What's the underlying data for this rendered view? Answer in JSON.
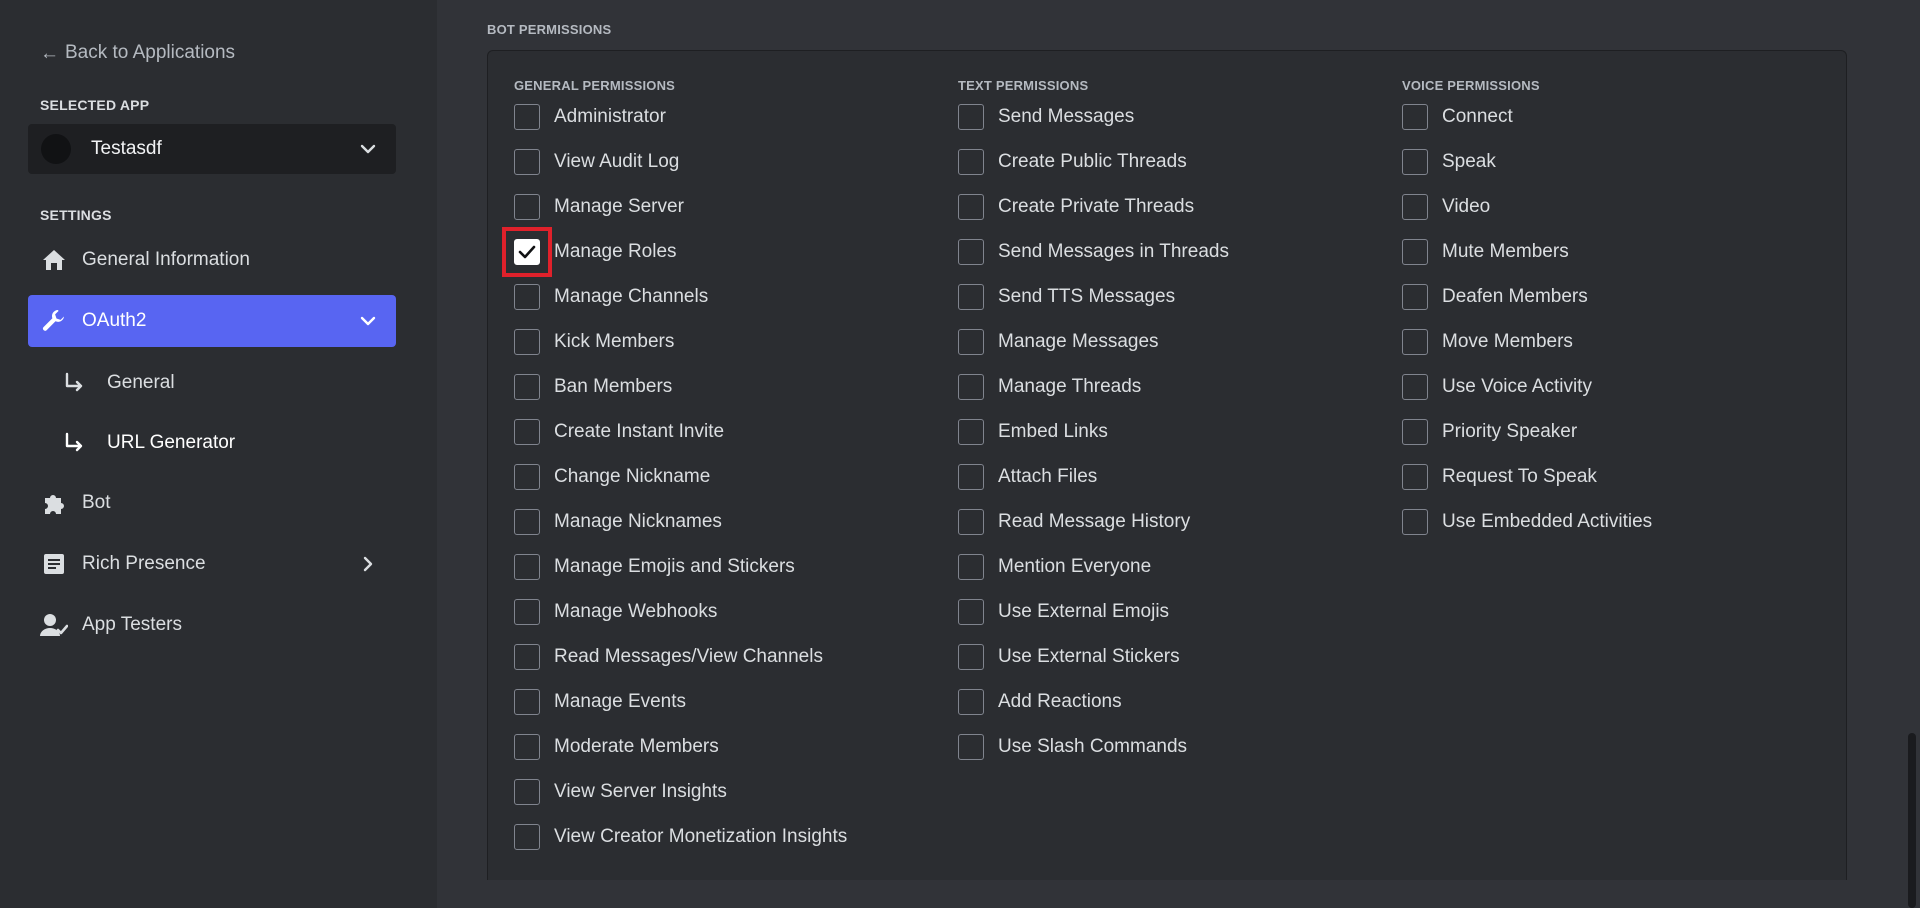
{
  "sidebar": {
    "back_label": "Back to Applications",
    "selected_app_label": "SELECTED APP",
    "app_name": "Testasdf",
    "settings_label": "SETTINGS",
    "items": [
      {
        "label": "General Information",
        "icon": "home-icon"
      },
      {
        "label": "OAuth2",
        "icon": "wrench-icon",
        "active": true,
        "expanded": true
      },
      {
        "label": "Bot",
        "icon": "puzzle-icon"
      },
      {
        "label": "Rich Presence",
        "icon": "document-icon"
      },
      {
        "label": "App Testers",
        "icon": "user-icon"
      }
    ],
    "oauth_sub_items": [
      {
        "label": "General"
      },
      {
        "label": "URL Generator",
        "current": true
      }
    ]
  },
  "main": {
    "heading": "BOT PERMISSIONS",
    "columns": [
      {
        "title": "GENERAL PERMISSIONS",
        "items": [
          {
            "label": "Administrator",
            "checked": false
          },
          {
            "label": "View Audit Log",
            "checked": false
          },
          {
            "label": "Manage Server",
            "checked": false
          },
          {
            "label": "Manage Roles",
            "checked": true,
            "highlighted": true
          },
          {
            "label": "Manage Channels",
            "checked": false
          },
          {
            "label": "Kick Members",
            "checked": false
          },
          {
            "label": "Ban Members",
            "checked": false
          },
          {
            "label": "Create Instant Invite",
            "checked": false
          },
          {
            "label": "Change Nickname",
            "checked": false
          },
          {
            "label": "Manage Nicknames",
            "checked": false
          },
          {
            "label": "Manage Emojis and Stickers",
            "checked": false
          },
          {
            "label": "Manage Webhooks",
            "checked": false
          },
          {
            "label": "Read Messages/View Channels",
            "checked": false
          },
          {
            "label": "Manage Events",
            "checked": false
          },
          {
            "label": "Moderate Members",
            "checked": false
          },
          {
            "label": "View Server Insights",
            "checked": false
          },
          {
            "label": "View Creator Monetization Insights",
            "checked": false
          }
        ]
      },
      {
        "title": "TEXT PERMISSIONS",
        "items": [
          {
            "label": "Send Messages",
            "checked": false
          },
          {
            "label": "Create Public Threads",
            "checked": false
          },
          {
            "label": "Create Private Threads",
            "checked": false
          },
          {
            "label": "Send Messages in Threads",
            "checked": false
          },
          {
            "label": "Send TTS Messages",
            "checked": false
          },
          {
            "label": "Manage Messages",
            "checked": false
          },
          {
            "label": "Manage Threads",
            "checked": false
          },
          {
            "label": "Embed Links",
            "checked": false
          },
          {
            "label": "Attach Files",
            "checked": false
          },
          {
            "label": "Read Message History",
            "checked": false
          },
          {
            "label": "Mention Everyone",
            "checked": false
          },
          {
            "label": "Use External Emojis",
            "checked": false
          },
          {
            "label": "Use External Stickers",
            "checked": false
          },
          {
            "label": "Add Reactions",
            "checked": false
          },
          {
            "label": "Use Slash Commands",
            "checked": false
          }
        ]
      },
      {
        "title": "VOICE PERMISSIONS",
        "items": [
          {
            "label": "Connect",
            "checked": false
          },
          {
            "label": "Speak",
            "checked": false
          },
          {
            "label": "Video",
            "checked": false
          },
          {
            "label": "Mute Members",
            "checked": false
          },
          {
            "label": "Deafen Members",
            "checked": false
          },
          {
            "label": "Move Members",
            "checked": false
          },
          {
            "label": "Use Voice Activity",
            "checked": false
          },
          {
            "label": "Priority Speaker",
            "checked": false
          },
          {
            "label": "Request To Speak",
            "checked": false
          },
          {
            "label": "Use Embedded Activities",
            "checked": false
          }
        ]
      }
    ]
  },
  "colors": {
    "accent": "#5865f2",
    "highlight": "#e0212b",
    "background": "#313338",
    "sidebar": "#2b2d31"
  }
}
